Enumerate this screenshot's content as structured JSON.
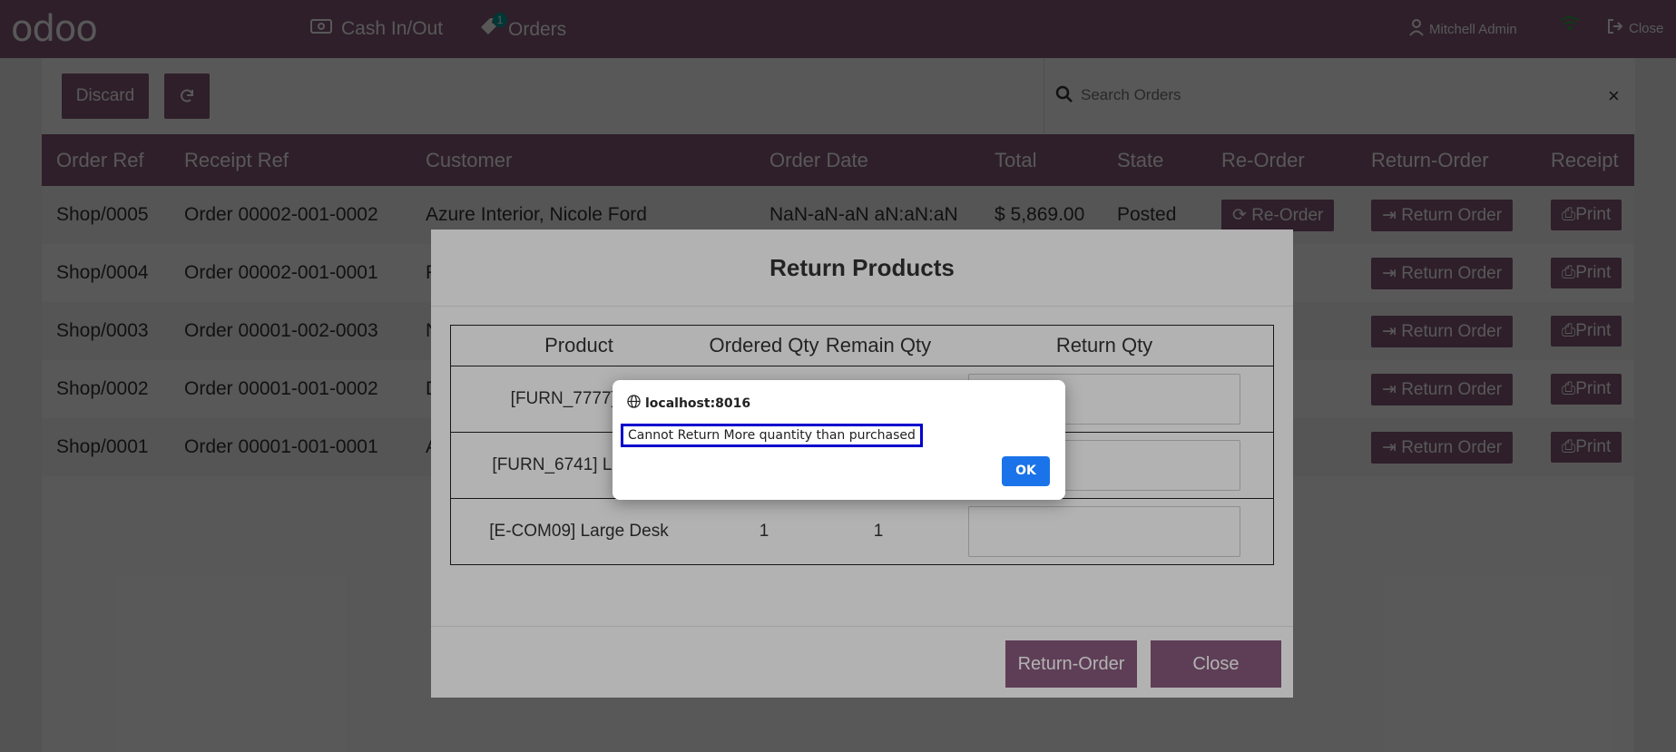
{
  "navbar": {
    "logo": "odoo",
    "cash_label": "Cash In/Out",
    "orders_label": "Orders",
    "orders_badge": "1",
    "user_label": "Mitchell Admin",
    "close_label": "Close"
  },
  "controls": {
    "discard_label": "Discard",
    "search_placeholder": "Search Orders",
    "clear_symbol": "×"
  },
  "orders_table": {
    "columns": [
      "Order Ref",
      "Receipt Ref",
      "Customer",
      "Order Date",
      "Total",
      "State",
      "Re-Order",
      "Return-Order",
      "Receipt"
    ],
    "rows": [
      {
        "ref": "Shop/0005",
        "receipt": "Order 00002-001-0002",
        "customer": "Azure Interior, Nicole Ford",
        "date": "NaN-aN-aN aN:aN:aN",
        "total": "$ 5,869.00",
        "state": "Posted",
        "reorder": "Re-Order",
        "return": "Return Order",
        "print": "Print"
      },
      {
        "ref": "Shop/0004",
        "receipt": "Order 00002-001-0001",
        "customer": "F",
        "date": "",
        "total": "",
        "state": "",
        "reorder": "er",
        "return": "Return Order",
        "print": "Print"
      },
      {
        "ref": "Shop/0003",
        "receipt": "Order 00001-002-0003",
        "customer": "N",
        "date": "",
        "total": "",
        "state": "",
        "reorder": "er",
        "return": "Return Order",
        "print": "Print"
      },
      {
        "ref": "Shop/0002",
        "receipt": "Order 00001-001-0002",
        "customer": "D",
        "date": "",
        "total": "",
        "state": "",
        "reorder": "er",
        "return": "Return Order",
        "print": "Print"
      },
      {
        "ref": "Shop/0001",
        "receipt": "Order 00001-001-0001",
        "customer": "A",
        "date": "",
        "total": "",
        "state": "",
        "reorder": "er",
        "return": "Return Order",
        "print": "Print"
      }
    ]
  },
  "return_modal": {
    "title": "Return Products",
    "columns": [
      "Product",
      "Ordered Qty",
      "Remain Qty",
      "Return Qty"
    ],
    "rows": [
      {
        "product": "[FURN_7777] Offi",
        "ordered": "",
        "remain": ""
      },
      {
        "product": "[FURN_6741] Large M",
        "ordered": "",
        "remain": ""
      },
      {
        "product": "[E-COM09] Large Desk",
        "ordered": "1",
        "remain": "1"
      }
    ],
    "return_order_label": "Return-Order",
    "close_label": "Close"
  },
  "alert": {
    "origin": "localhost:8016",
    "message": "Cannot Return More quantity than purchased",
    "ok_label": "OK"
  },
  "colors": {
    "brand": "#875a7b",
    "alert_button": "#1a73e8",
    "highlight_border": "#0000cc"
  }
}
